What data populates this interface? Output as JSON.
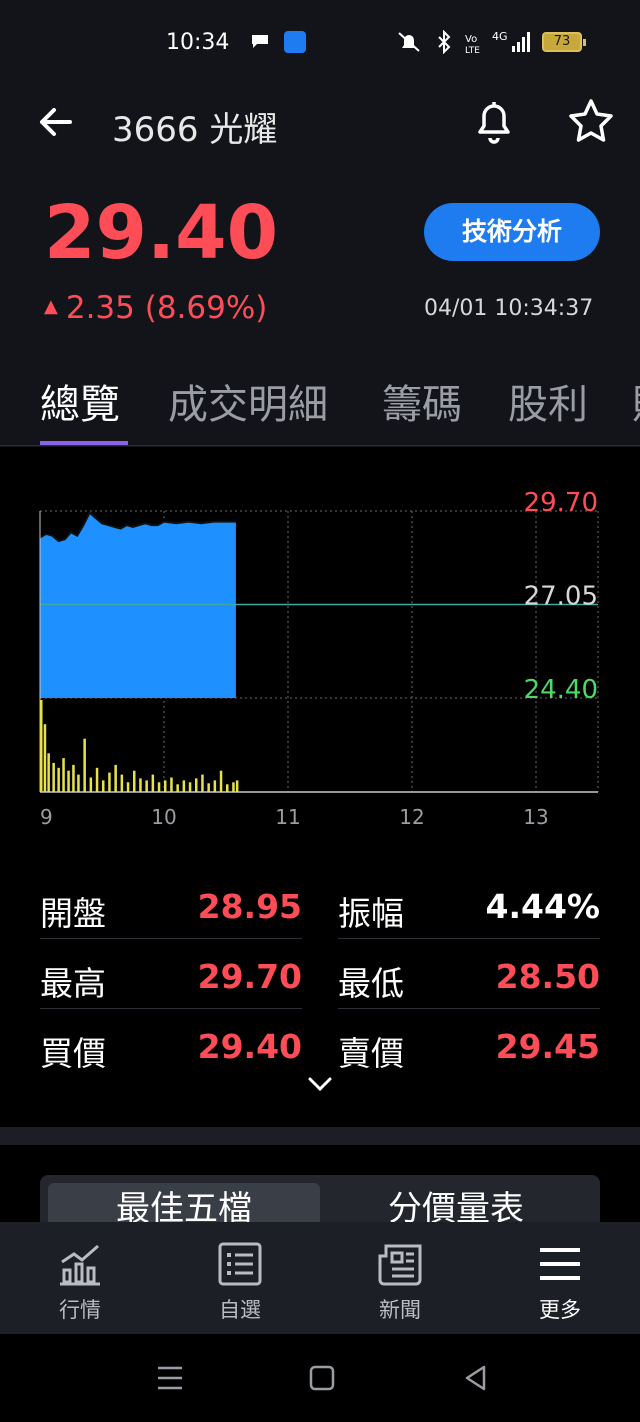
{
  "status_bar": {
    "time": "10:34",
    "battery": "73",
    "network": "4G"
  },
  "header": {
    "title": "3666 光耀"
  },
  "quote": {
    "price": "29.40",
    "change": "2.35 (8.69%)",
    "time": "04/01 10:34:37",
    "ta_button": "技術分析"
  },
  "tabs": [
    {
      "label": "總覽"
    },
    {
      "label": "成交明細"
    },
    {
      "label": "籌碼"
    },
    {
      "label": "股利"
    }
  ],
  "chart_data": {
    "type": "area",
    "title": "",
    "y_labels": {
      "high": "29.70",
      "ref": "27.05",
      "low": "24.40"
    },
    "ylim": [
      24.4,
      29.7
    ],
    "x_ticks": [
      "9",
      "10",
      "11",
      "12",
      "13"
    ],
    "price_series": {
      "x_hours": [
        9.0,
        9.05,
        9.1,
        9.15,
        9.2,
        9.25,
        9.3,
        9.35,
        9.4,
        9.45,
        9.5,
        9.55,
        9.6,
        9.65,
        9.7,
        9.75,
        9.8,
        9.85,
        9.9,
        9.95,
        10.0,
        10.1,
        10.2,
        10.3,
        10.4,
        10.5,
        10.58
      ],
      "y": [
        28.95,
        29.05,
        29.0,
        28.85,
        28.9,
        29.1,
        29.0,
        29.3,
        29.65,
        29.5,
        29.35,
        29.3,
        29.25,
        29.2,
        29.3,
        29.25,
        29.3,
        29.35,
        29.3,
        29.3,
        29.4,
        29.35,
        29.4,
        29.35,
        29.4,
        29.4,
        29.4
      ]
    },
    "volume_series": {
      "x_hours": [
        9.0,
        9.03,
        9.06,
        9.1,
        9.14,
        9.18,
        9.22,
        9.26,
        9.3,
        9.35,
        9.4,
        9.45,
        9.5,
        9.55,
        9.6,
        9.65,
        9.7,
        9.75,
        9.8,
        9.85,
        9.9,
        9.95,
        10.0,
        10.05,
        10.1,
        10.15,
        10.2,
        10.25,
        10.3,
        10.35,
        10.4,
        10.45,
        10.5,
        10.55,
        10.58
      ],
      "values": [
        95,
        70,
        40,
        30,
        25,
        35,
        22,
        28,
        18,
        55,
        15,
        25,
        12,
        20,
        28,
        18,
        10,
        22,
        14,
        12,
        18,
        10,
        12,
        15,
        8,
        12,
        10,
        14,
        18,
        9,
        12,
        22,
        8,
        10,
        12
      ]
    }
  },
  "stats": [
    {
      "label": "開盤",
      "value": "28.95",
      "color": "#ff4d57"
    },
    {
      "label": "振幅",
      "value": "4.44%",
      "color": "#ffffff"
    },
    {
      "label": "最高",
      "value": "29.70",
      "color": "#ff4d57"
    },
    {
      "label": "最低",
      "value": "28.50",
      "color": "#ff4d57"
    },
    {
      "label": "買價",
      "value": "29.40",
      "color": "#ff4d57"
    },
    {
      "label": "賣價",
      "value": "29.45",
      "color": "#ff4d57"
    }
  ],
  "lower_tabs": {
    "left": "最佳五檔",
    "right": "分價量表"
  },
  "bottom_nav": [
    {
      "label": "行情",
      "icon": "chart-icon"
    },
    {
      "label": "自選",
      "icon": "list-icon"
    },
    {
      "label": "新聞",
      "icon": "news-icon"
    },
    {
      "label": "更多",
      "icon": "menu-icon"
    }
  ],
  "colors": {
    "up": "#ff4d57",
    "down": "#4cd964",
    "accent": "#1e7bf0",
    "area": "#1e90ff",
    "volume": "#e8e24a"
  }
}
